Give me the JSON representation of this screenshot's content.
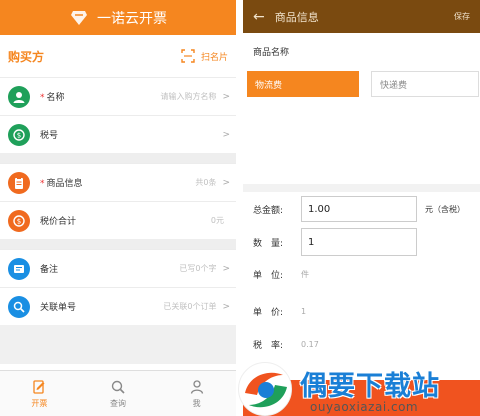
{
  "left": {
    "app_title": "一诺云开票",
    "buyer_section": "购买方",
    "scan_label": "扫名片",
    "rows": [
      {
        "label": "名称",
        "required": true,
        "value": "请输入购方名称",
        "color": "#1fa05a"
      },
      {
        "label": "税号",
        "required": false,
        "value": "",
        "color": "#1fa05a"
      },
      {
        "label": "商品信息",
        "required": true,
        "value": "共0条",
        "color": "#f06a1f"
      },
      {
        "label": "税价合计",
        "required": false,
        "value": "0元",
        "color": "#f06a1f"
      },
      {
        "label": "备注",
        "required": false,
        "value": "已写0个字",
        "color": "#1a8fe3"
      },
      {
        "label": "关联单号",
        "required": false,
        "value": "已关联0个订单",
        "color": "#1a8fe3"
      }
    ],
    "tabs": [
      {
        "label": "开票",
        "icon": "edit-doc-icon",
        "active": true
      },
      {
        "label": "查询",
        "icon": "search-icon",
        "active": false
      },
      {
        "label": "我",
        "icon": "user-icon",
        "active": false
      }
    ]
  },
  "right": {
    "title": "商品信息",
    "save_label": "保存",
    "product_name_label": "商品名称",
    "options": [
      "物流费",
      "快递费"
    ],
    "fields": {
      "total_label": "总金额:",
      "total_value": "1.00",
      "total_unit": "元（含税）",
      "qty_label": "数　量:",
      "qty_value": "1",
      "unit_label": "单　位:",
      "unit_value": "件",
      "price_label": "单　价:",
      "price_value": "1",
      "tax_label": "税　率:",
      "tax_value": "0.17"
    }
  },
  "watermark": {
    "title": "偶要下载站",
    "url": "ouyaoxiazai.com"
  },
  "colors": {
    "accent": "#f5861f",
    "header_dark": "#7a4a10",
    "submit": "#f0531f"
  }
}
